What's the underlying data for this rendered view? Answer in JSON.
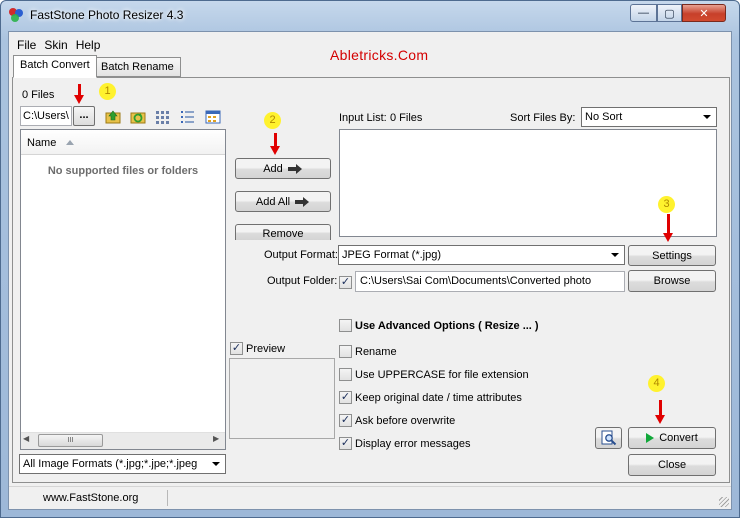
{
  "window": {
    "title": "FastStone Photo Resizer 4.3",
    "min_glyph": "—",
    "max_glyph": "▢",
    "close_glyph": "✕"
  },
  "menu": [
    "File",
    "Skin",
    "Help"
  ],
  "watermark": "Abletricks.Com",
  "tabs": [
    "Batch Convert",
    "Batch Rename"
  ],
  "browser": {
    "files_count": "0 Files",
    "folder_path": "C:\\Users\\",
    "browse_label": "...",
    "column_name": "Name",
    "empty_message": "No supported files or folders",
    "format_filter": "All Image Formats (*.jpg;*.jpe;*.jpeg",
    "scroll_thumb_glyph": "III"
  },
  "buttons": {
    "add": "Add",
    "add_all": "Add All",
    "remove": "Remove",
    "settings": "Settings",
    "browse": "Browse",
    "convert": "Convert",
    "close": "Close"
  },
  "input_list": {
    "label": "Input List:",
    "count": "0 Files"
  },
  "sort": {
    "label": "Sort Files By:",
    "value": "No Sort"
  },
  "output": {
    "format_label": "Output Format:",
    "format_value": "JPEG Format (*.jpg)",
    "folder_label": "Output Folder:",
    "folder_checked": true,
    "folder_value": "C:\\Users\\Sai Com\\Documents\\Converted photo"
  },
  "options": [
    {
      "label": "Use Advanced Options ( Resize ... )",
      "checked": false
    },
    {
      "label": "Rename",
      "checked": false
    },
    {
      "label": "Use UPPERCASE for file extension",
      "checked": false
    },
    {
      "label": "Keep original date / time attributes",
      "checked": true
    },
    {
      "label": "Ask before overwrite",
      "checked": true
    },
    {
      "label": "Display error messages",
      "checked": true
    }
  ],
  "preview": {
    "label": "Preview",
    "checked": true
  },
  "annotations": [
    "1",
    "2",
    "3",
    "4"
  ],
  "status": {
    "text": "www.FastStone.org"
  },
  "colors": {
    "annotation_arrow": "#e00000",
    "annotation_badge": "#fff22e",
    "watermark": "#d40000",
    "convert_play": "#11a83a"
  }
}
